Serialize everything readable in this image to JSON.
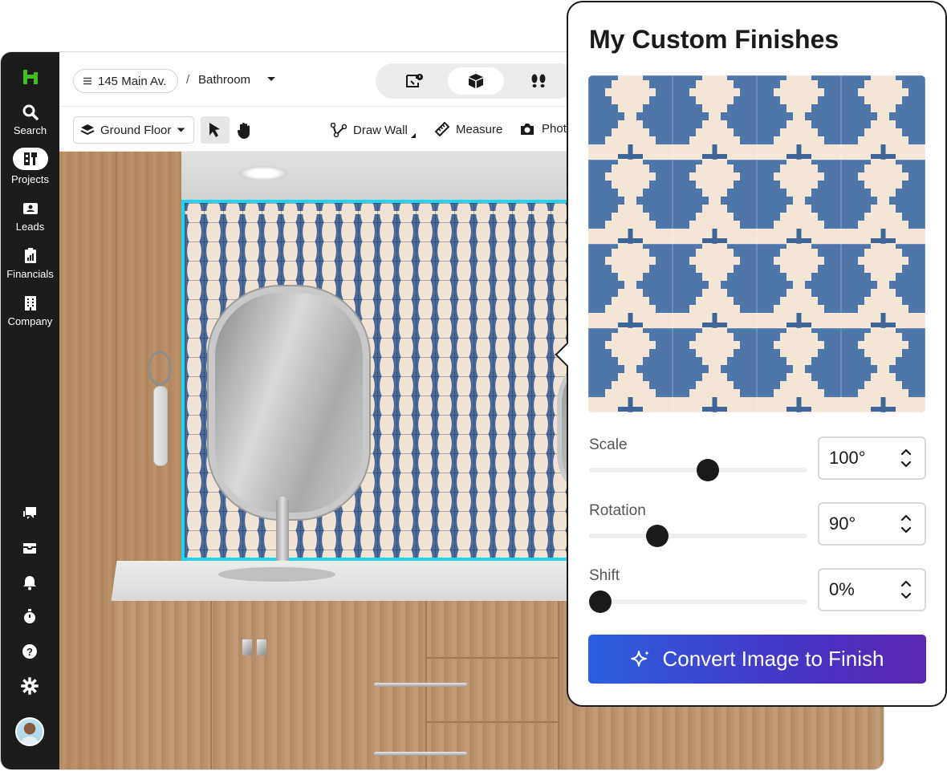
{
  "sidebar": {
    "items": [
      {
        "label": "Search",
        "icon": "search-icon"
      },
      {
        "label": "Projects",
        "icon": "projects-icon"
      },
      {
        "label": "Leads",
        "icon": "leads-icon"
      },
      {
        "label": "Financials",
        "icon": "financials-icon"
      },
      {
        "label": "Company",
        "icon": "company-icon"
      }
    ],
    "bottom_icons": [
      "chat-icon",
      "inbox-icon",
      "bell-icon",
      "timer-icon",
      "help-icon",
      "gear-icon"
    ]
  },
  "header": {
    "address": "145 Main Av.",
    "separator": "/",
    "room": "Bathroom"
  },
  "toolbar": {
    "floor": "Ground Floor",
    "draw_wall": "Draw Wall",
    "measure": "Measure",
    "photo": "Phot"
  },
  "panel": {
    "title": "My Custom Finishes",
    "controls": [
      {
        "label": "Scale",
        "value": "100°",
        "level": 0.55
      },
      {
        "label": "Rotation",
        "value": "90°",
        "level": 0.29
      },
      {
        "label": "Shift",
        "value": "0%",
        "level": 0.0
      }
    ],
    "convert_label": "Convert Image to Finish"
  },
  "colors": {
    "accent_outline": "#22d3ee",
    "tile_blue": "#4e76a8",
    "tile_cream": "#f3e6d6",
    "button_start": "#2b5fe0",
    "button_end": "#5a28b0",
    "sidebar_bg": "#1c1c1c",
    "brand_green": "#3fbf1f"
  }
}
